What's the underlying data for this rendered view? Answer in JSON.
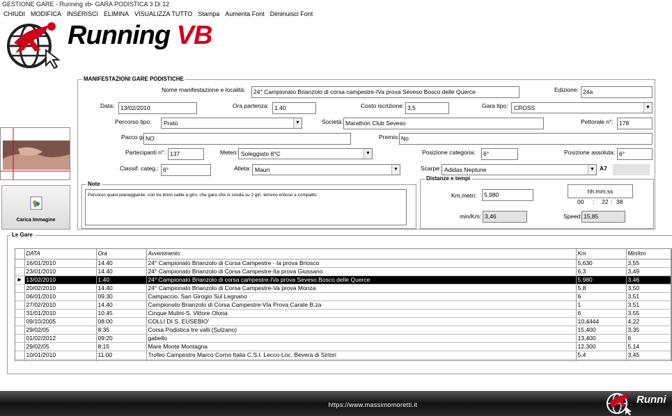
{
  "window": {
    "title": "GESTIONE GARE - Running vb- GARA PODISTICA 3 Di 12"
  },
  "menu": [
    "CHIUDI",
    "MODIFICA",
    "INSERISCI",
    "ELIMINA",
    "VISUALIZZA TUTTO",
    "Stampa",
    "Aumenta Font",
    "Diminuisci Font"
  ],
  "logo": {
    "text_main": "Running ",
    "text_accent": "VB"
  },
  "side": {
    "load_image_label": "Carica Immagine"
  },
  "form": {
    "group_title": "MANIFESTAZIONI GARE PODISTICHE",
    "nome_label": "Nome manifestazione e località:",
    "nome_value": "24° Campionato Brianzolo di corsa campestre-IVa prova Seveso Bosco delle Querce",
    "edizione_label": "Edizione:",
    "edizione_value": "24a",
    "data_label": "Data:",
    "data_value": "13/02/2010",
    "ora_label": "Ora partenza:",
    "ora_value": "1.40",
    "costo_label": "Costo iscrizione:",
    "costo_value": "3,5",
    "garatipo_label": "Gara tipo:",
    "garatipo_value": "CROSS",
    "percorso_label": "Percorso tipo:",
    "percorso_value": "Prato",
    "societa_label": "Società:",
    "societa_value": "Marathon Club Seveso",
    "pettorale_label": "Pettorale n°:",
    "pettorale_value": "178",
    "pacco_label": "Pacco gara:",
    "pacco_value": "NO",
    "premio_label": "Premio:",
    "premio_value": "No",
    "partecipanti_label": "Partecipanti n°:",
    "partecipanti_value": "137",
    "meteo_label": "Meteo:",
    "meteo_value": "Soleggiato 8°C",
    "poscat_label": "Posizione categoria:",
    "poscat_value": "6°",
    "posass_label": "Posizione assoluta:",
    "posass_value": "6°",
    "classif_label": "Classif. categ.:",
    "classif_value": "6°",
    "atleta_label": "Atleta:",
    "atleta_value": "Mauri",
    "scarpe_label": "Scarpe:",
    "scarpe_value": "Adidas Neptune",
    "scarpe_code": "A7"
  },
  "note": {
    "title": "Note",
    "text": "Percorso quasi pianeggiante, con tre brevi salite a giro, che gara che si snoda su 2 giri. terreno erboso e compatto"
  },
  "distanze": {
    "title": "Distanze e tempi",
    "km_label": "Km,metri:",
    "km_value": "5,980",
    "time_format": "hh:mm:ss",
    "hh": "00",
    "mm": "22",
    "ss": "38",
    "sep": ":",
    "minkm_label": "min/Km:",
    "minkm_value": "3,46",
    "speed_label": "Speed:",
    "speed_value": "15,85"
  },
  "gare": {
    "title": "Le Gare",
    "columns": [
      "DATA",
      "Ora",
      "Avvenimento",
      "Km",
      "Min/km"
    ],
    "selected_marker": "▶",
    "rows": [
      [
        "16/01/2010",
        "14.40",
        "24° Campionato Brianzolo di Corsa Campestre - Ia prova Briosco",
        "5,630",
        "3,55"
      ],
      [
        "23/01/2010",
        "14.40",
        "24° Campionato Brianzolo di Corsa Campestre-IIa prova Giussano",
        "6,3",
        "3,49"
      ],
      [
        "13/02/2010",
        "1.40",
        "24° Campionato Brianzolo di corsa campestre-IVa prova Seveso Bosco delle Querce",
        "5,980",
        "3,46"
      ],
      [
        "20/02/2010",
        "14.40",
        "24° Campionato Brianzolo di Corsa Campestre-Va prova Monza",
        "5,8",
        "3,50"
      ],
      [
        "06/01/2010",
        "09.30",
        "Campaccio, San Girogio Sul Legnano",
        "6",
        "3,51"
      ],
      [
        "27/02/2010",
        "14.40",
        "Campionato Brianzolo di Corsa Campestre-VIa Prova Carate B.za",
        "1",
        "3,51"
      ],
      [
        "31/01/2010",
        "10.45",
        "Cinque Mulini-S. Vittore Olona",
        "6",
        "3,55"
      ],
      [
        "09/10/2005",
        "08:00",
        "COLLI DI S. EUSEBIO'",
        "10,4444",
        "4,22"
      ],
      [
        "29/02/05",
        "8:35",
        "Corsa Podistica tre valli (Sulzano)",
        "15,400",
        "3,35"
      ],
      [
        "01/02/2012",
        "09:20",
        "gabello",
        "13,400",
        "6"
      ],
      [
        "29/02/05",
        "8:15",
        "Mare Monte Montagna",
        "12,300",
        "5,14"
      ],
      [
        "10/01/2010",
        "11.00",
        "Trofeo Campestre Marco Corno Italia C.S.I. Lecco-Loc. Bevera di Sirtori",
        "5,4",
        "3,45"
      ]
    ],
    "selected_index": 2
  },
  "footer": {
    "url": "https://www.massimomoretti.it",
    "logo_text": "Runni"
  }
}
